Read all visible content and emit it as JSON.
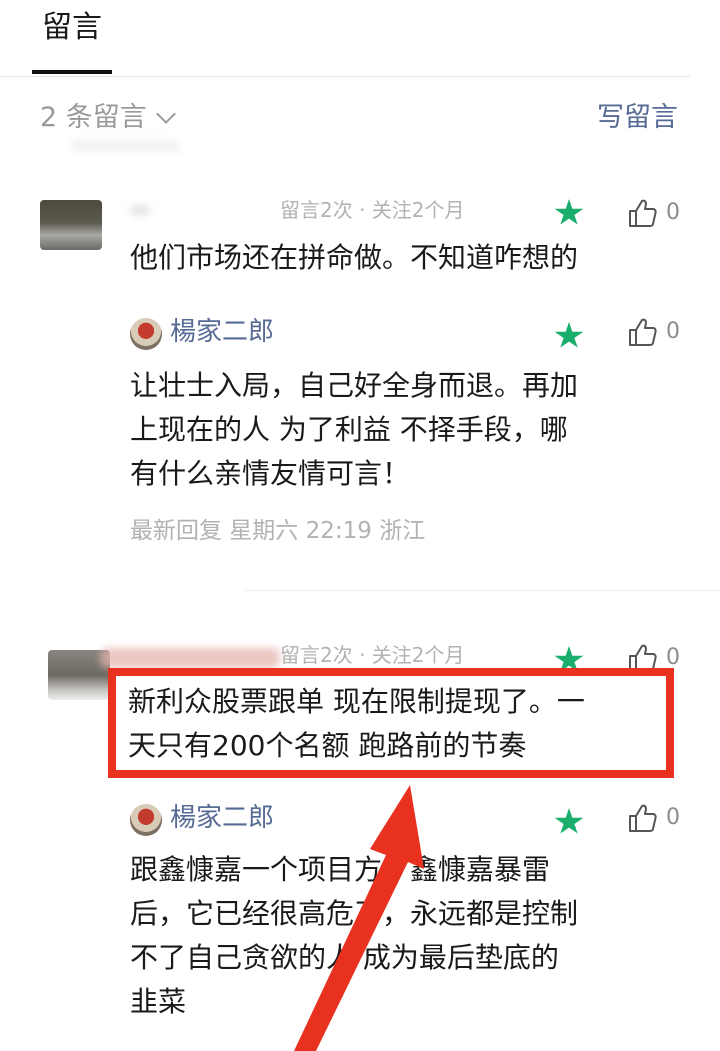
{
  "header": {
    "tab_label": "留言"
  },
  "toolbar": {
    "count_label": "2 条留言",
    "write_label": "写留言"
  },
  "comments": [
    {
      "meta": "留言2次 · 关注2个月",
      "text_lines": [
        "他们市场还在拼命做。不知道咋想的"
      ],
      "like_count": "0",
      "reply": {
        "author": "楊家二郎",
        "like_count": "0",
        "text_lines": [
          "让壮士入局，自己好全身而退。再加",
          "上现在的人 为了利益 不择手段，哪",
          "有什么亲情友情可言！"
        ],
        "info": "最新回复  星期六  22:19  浙江"
      }
    },
    {
      "meta": "留言2次 · 关注2个月",
      "text_lines": [
        "新利众股票跟单 现在限制提现了。一",
        "天只有200个名额 跑路前的节奏"
      ],
      "like_count": "0",
      "reply": {
        "author": "楊家二郎",
        "like_count": "0",
        "text_lines": [
          "跟鑫慷嘉一个项目方，鑫慷嘉暴雷",
          "后，它已经很高危了，永远都是控制",
          "不了自己贪欲的人 成为最后垫底的",
          "韭菜"
        ]
      }
    }
  ],
  "colors": {
    "link": "#576b95",
    "star": "#1aad6c",
    "highlight": "#e8321f",
    "muted": "#b2b2b2"
  },
  "icons": {
    "star": "star-icon",
    "like": "thumbs-up-icon",
    "chevron": "chevron-down-icon",
    "arrow": "arrow-annotation"
  }
}
